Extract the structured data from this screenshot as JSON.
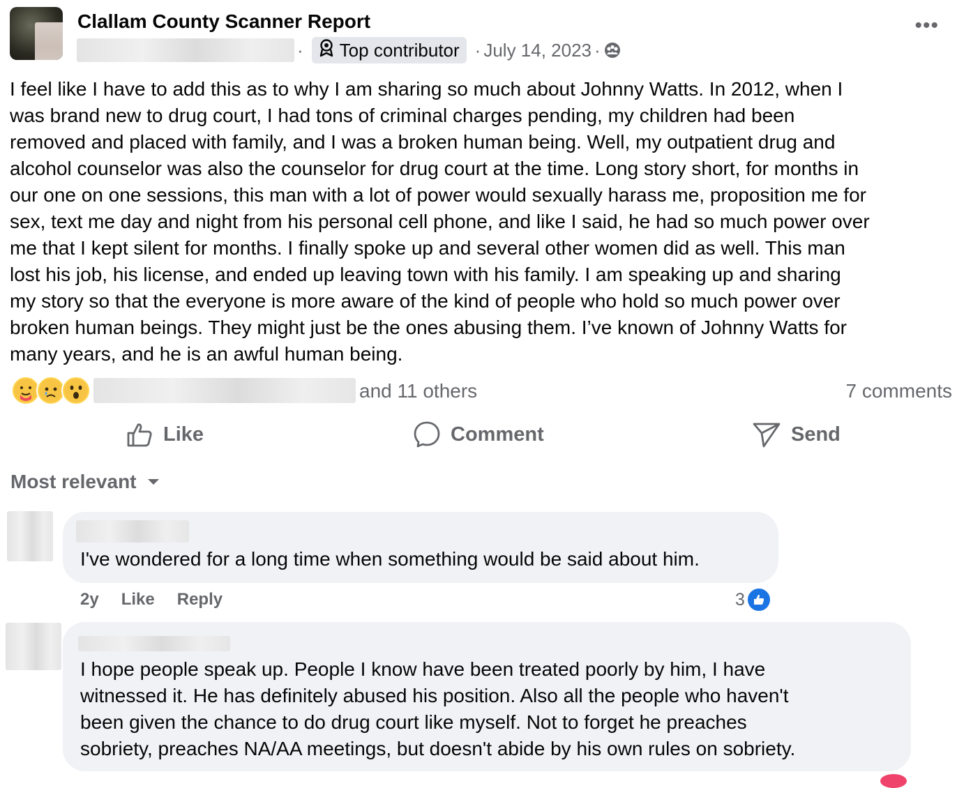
{
  "post": {
    "group_name": "Clallam County Scanner Report",
    "badge_label": "Top contributor",
    "separator": "·",
    "date": "July 14, 2023",
    "privacy_icon": "group-privacy-icon",
    "more_label": "•••",
    "text": "I feel like I have to add this as to why I am sharing so much about Johnny Watts. In 2012, when I\nwas brand new to drug court, I had tons of criminal charges pending, my children had been\nremoved and placed with family, and I was a broken human being. Well, my outpatient drug and\nalcohol counselor was also the counselor for drug court at the time. Long story short, for months in\nour one on one sessions, this man with a lot of power would sexually harass me, proposition me for\nsex, text me day and night from his personal cell phone, and like I said, he had so much power over\nme that I kept silent for months. I finally spoke up and several other women did as well. This man\nlost his job, his license, and ended up leaving town with his family. I am speaking up and sharing\nmy story so that the everyone is more aware of the kind of people who hold so much power over\nbroken human beings. They might just be the ones abusing them. I’ve known of Johnny Watts for\nmany years, and he is an awful human being."
  },
  "reactions": {
    "icons": [
      "care-emoji",
      "sad-emoji",
      "wow-emoji"
    ],
    "others_text": "and 11 others",
    "comments_count": "7 comments"
  },
  "actions": {
    "like": "Like",
    "comment": "Comment",
    "send": "Send"
  },
  "sort_label": "Most relevant",
  "comments": [
    {
      "text": "I've wondered for a long time when something would be said about him.",
      "age": "2y",
      "like_action": "Like",
      "reply_action": "Reply",
      "like_count": "3"
    },
    {
      "text": "I hope people speak up. People I know have been treated poorly by him, I have\nwitnessed it. He has definitely abused his position. Also all the people who haven't\nbeen given the chance to do drug court like myself. Not to forget he preaches\nsobriety, preaches NA/AA meetings, but doesn't abide by his own rules on sobriety."
    }
  ],
  "colors": {
    "secondary_text": "#65676b",
    "bubble_bg": "#f0f2f5",
    "like_blue": "#1b74e4"
  }
}
